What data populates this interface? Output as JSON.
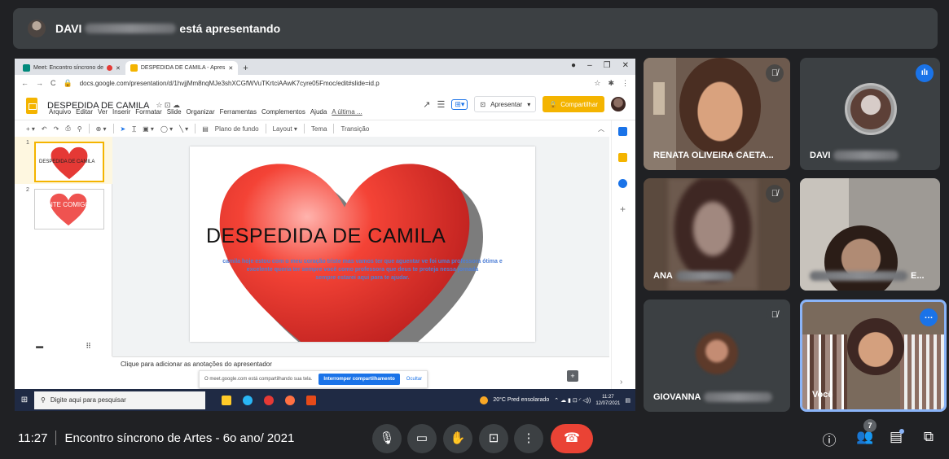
{
  "presenter": {
    "first_name": "DAVI",
    "status": "está apresentando"
  },
  "browser": {
    "tabs": [
      {
        "label": "Meet: Encontro síncrono de"
      },
      {
        "label": "DESPEDIDA DE CAMILA - Apres"
      }
    ],
    "url": "docs.google.com/presentation/d/1hvjjMm8nqMJe3shXCGfWVuTKrtciAAwK7cyre05Fmoc/edit#slide=id.p"
  },
  "slides_app": {
    "title": "DESPEDIDA DE CAMILA",
    "menu": [
      "Arquivo",
      "Editar",
      "Ver",
      "Inserir",
      "Formatar",
      "Slide",
      "Organizar",
      "Ferramentas",
      "Complementos",
      "Ajuda"
    ],
    "last_edit": "A última ...",
    "present_label": "Apresentar",
    "share_label": "Compartilhar",
    "toolbar": {
      "background": "Plano de fundo",
      "layout": "Layout",
      "theme": "Tema",
      "transition": "Transição"
    },
    "thumbnails": [
      {
        "number": "1",
        "text": "DESPEDIDA DE CAMILA"
      },
      {
        "number": "2",
        "text": "CONTE COMIGO"
      }
    ],
    "slide": {
      "title": "DESPEDIDA  DE CAMILA",
      "body_lines": [
        "camila hoje estou com o meu coração triste mas vamos ter que aguentar ve foi uma professora ótima e",
        "excelente queria ter sempre você como professora que deus te proteja nessa jornada",
        "sempre estarei aqui para te ajudar."
      ]
    },
    "notes_placeholder": "Clique para adicionar as anotações do apresentador",
    "share_notice": {
      "text": "O meet.google.com está compartilhando sua tela.",
      "stop_label": "Interromper compartilhamento",
      "hide_label": "Ocultar"
    }
  },
  "taskbar": {
    "search_placeholder": "Digite aqui para pesquisar",
    "weather": "20°C  Pred ensolarado",
    "time": "11:27",
    "date": "12/07/2021"
  },
  "participants": [
    {
      "name": "RENATA OLIVEIRA CAETA..."
    },
    {
      "name": "DAVI"
    },
    {
      "name": "ANA"
    },
    {
      "name": "E..."
    },
    {
      "name": "GIOVANNA"
    },
    {
      "name": "Você"
    }
  ],
  "meeting": {
    "time": "11:27",
    "title": "Encontro síncrono de Artes - 6o ano/ 2021",
    "people_count": "7"
  }
}
